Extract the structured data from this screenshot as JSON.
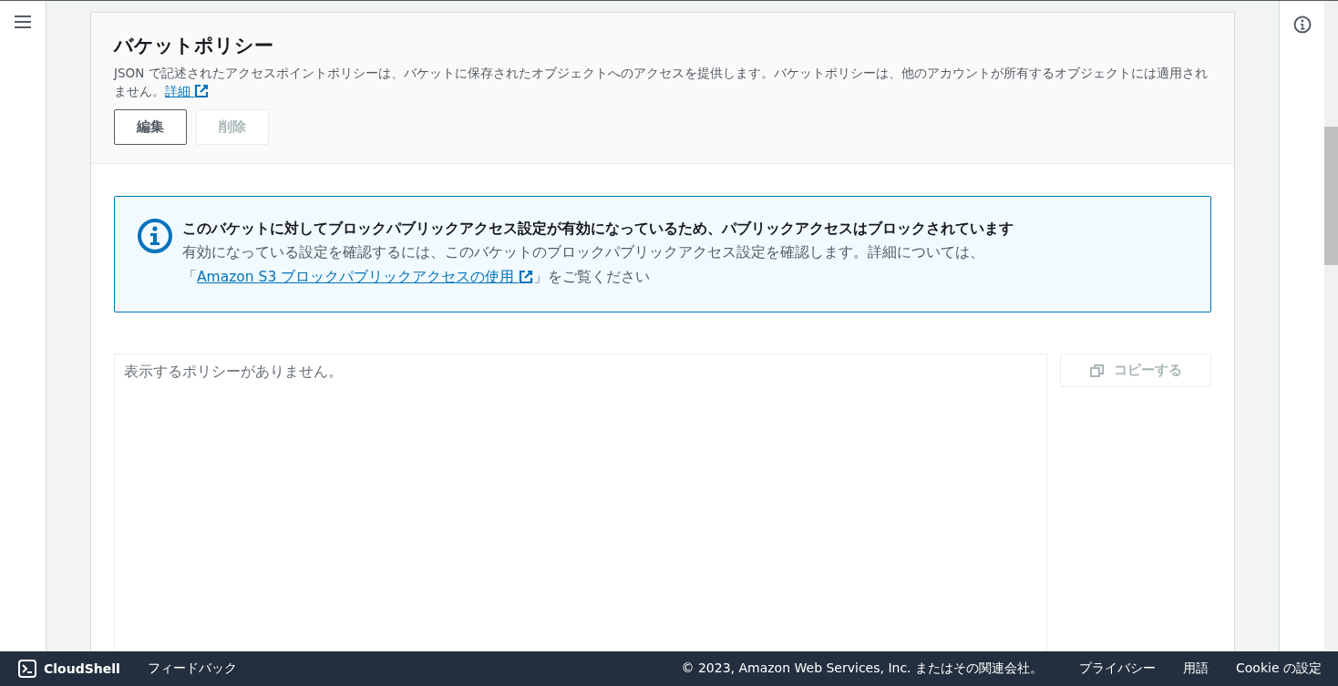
{
  "section": {
    "title": "バケットポリシー",
    "description": {
      "text": "JSON で記述されたアクセスポイントポリシーは、バケットに保存されたオブジェクトへのアクセスを提供します。バケットポリシーは、他のアカウントが所有するオブジェクトには適用されません。",
      "link": "詳細"
    },
    "buttons": [
      {
        "label": "編集",
        "disabled": false
      },
      {
        "label": "削除",
        "disabled": true
      }
    ]
  },
  "alert": {
    "title": "このバケットに対してブロックパブリックアクセス設定が有効になっているため、パブリックアクセスはブロックされています",
    "body_before": "有効になっている設定を確認するには、このバケットのブロックパブリックアクセス設定を確認します。詳細については、「",
    "link": "Amazon S3 ブロックパブリックアクセスの使用",
    "body_after": "」をご覧ください"
  },
  "policy": {
    "placeholder": "表示するポリシーがありません。",
    "copy_button": {
      "label": "コピーする",
      "disabled": true
    }
  },
  "footer": {
    "cloudshell": "CloudShell",
    "feedback": "フィードバック",
    "copyright": "© 2023, Amazon Web Services, Inc. またはその関連会社。",
    "links": [
      "プライバシー",
      "用語",
      "Cookie の設定"
    ]
  }
}
